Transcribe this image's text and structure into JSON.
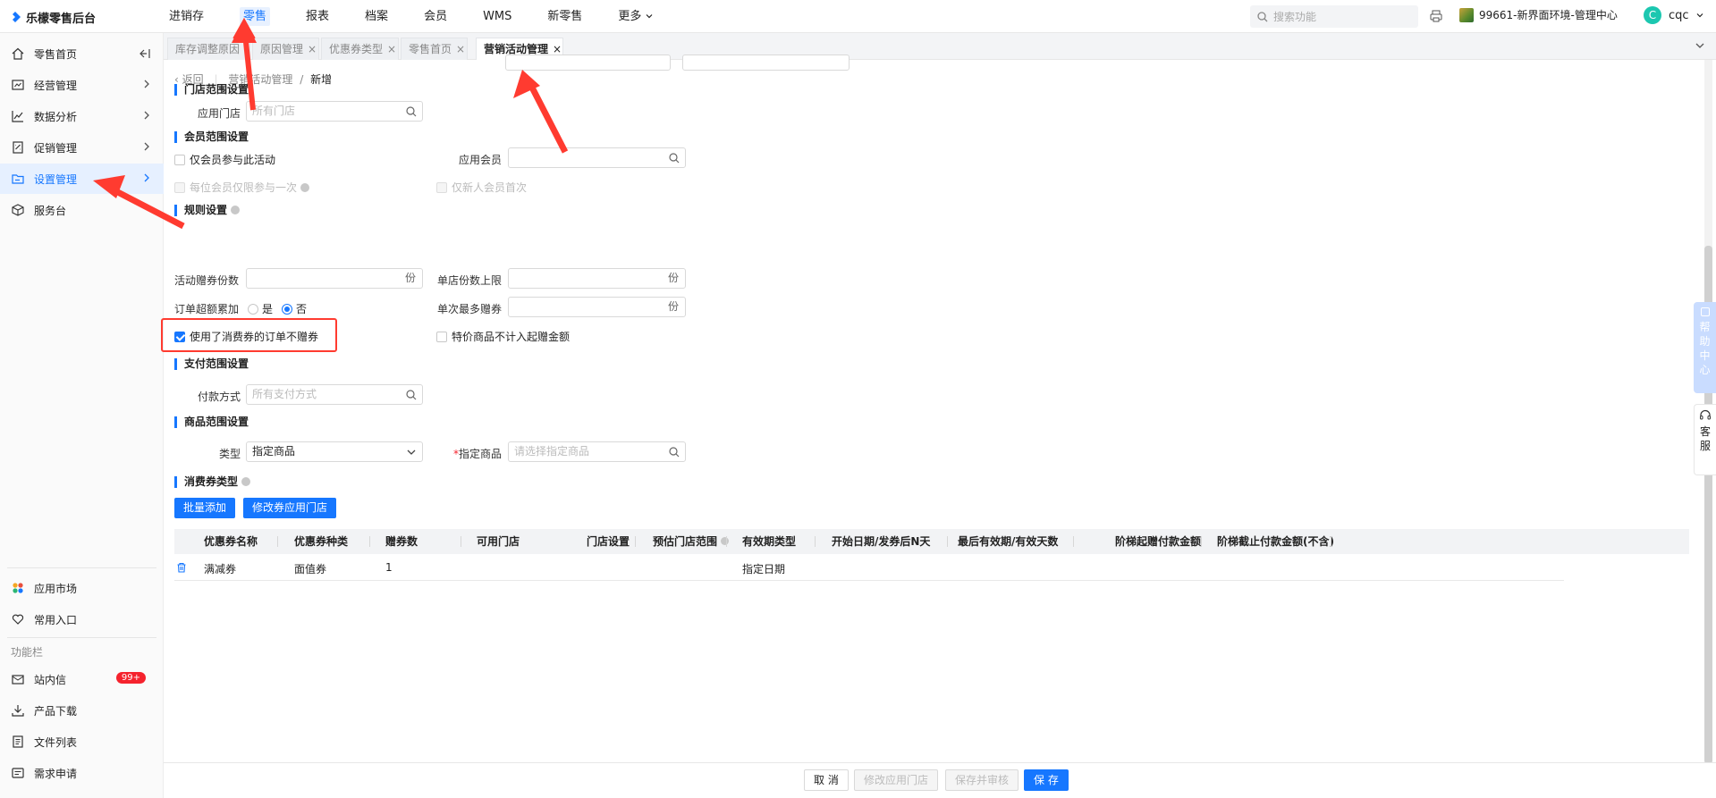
{
  "app": {
    "title": "乐檬零售后台"
  },
  "nav": {
    "items": [
      "进销存",
      "零售",
      "报表",
      "档案",
      "会员",
      "WMS",
      "新零售",
      "更多"
    ],
    "active": "零售"
  },
  "header": {
    "search_placeholder": "搜索功能",
    "store": "99661-新界面环境-管理中心",
    "user_initial": "C",
    "user_name": "cqc"
  },
  "sidebar": {
    "items": [
      {
        "label": "零售首页",
        "icon": "home-icon"
      },
      {
        "label": "经营管理",
        "icon": "chart-board-icon"
      },
      {
        "label": "数据分析",
        "icon": "line-chart-icon"
      },
      {
        "label": "促销管理",
        "icon": "promotion-icon"
      },
      {
        "label": "设置管理",
        "icon": "folder-icon"
      },
      {
        "label": "服务台",
        "icon": "cube-icon"
      }
    ],
    "bottom_items": [
      {
        "label": "应用市场",
        "icon": "app-market-icon"
      },
      {
        "label": "常用入口",
        "icon": "heart-icon"
      }
    ],
    "section_label": "功能栏",
    "function_items": [
      {
        "label": "站内信",
        "icon": "mail-icon",
        "badge": "99+"
      },
      {
        "label": "产品下载",
        "icon": "download-icon"
      },
      {
        "label": "文件列表",
        "icon": "file-list-icon"
      },
      {
        "label": "需求申请",
        "icon": "request-icon"
      }
    ]
  },
  "tabs": [
    {
      "label": "库存调整原因"
    },
    {
      "label": "原因管理"
    },
    {
      "label": "优惠券类型"
    },
    {
      "label": "零售首页"
    },
    {
      "label": "营销活动管理"
    }
  ],
  "breadcrumb": {
    "back": "返回",
    "parent": "营销活动管理",
    "sep": "/",
    "current": "新增"
  },
  "sections": {
    "store_scope": {
      "title": "门店范围设置",
      "store_label": "应用门店",
      "store_placeholder": "所有门店"
    },
    "member_scope": {
      "title": "会员范围设置",
      "only_member": "仅会员参与此活动",
      "member_label": "应用会员",
      "once_per_member": "每位会员仅限参与一次",
      "new_member_first": "仅新人会员首次"
    },
    "rules": {
      "title": "规则设置",
      "gift_count_label": "活动赠券份数",
      "unit": "份",
      "store_limit_label": "单店份数上限",
      "overflow_label": "订单超额累加",
      "opt_yes": "是",
      "opt_no": "否",
      "single_max_label": "单次最多赠券",
      "coupon_used_no_gift": "使用了消费券的订单不赠券",
      "special_price_excluded": "特价商品不计入起赠金额"
    },
    "payment_scope": {
      "title": "支付范围设置",
      "pay_label": "付款方式",
      "pay_placeholder": "所有支付方式"
    },
    "product_scope": {
      "title": "商品范围设置",
      "type_label": "类型",
      "type_value": "指定商品",
      "specify_label": "指定商品",
      "required_mark": "*",
      "specify_placeholder": "请选择指定商品"
    },
    "coupon_type": {
      "title": "消费券类型",
      "batch_add": "批量添加",
      "modify_store": "修改券应用门店"
    }
  },
  "table": {
    "headers": [
      "优惠券名称",
      "优惠券种类",
      "赠券数",
      "可用门店",
      "门店设置",
      "预估门店范围",
      "有效期类型",
      "开始日期/发券后N天",
      "最后有效期/有效天数",
      "阶梯起赠付款金额",
      "阶梯截止付款金额(不含)"
    ],
    "rows": [
      {
        "name": "满减券",
        "kind": "面值券",
        "count": "1",
        "validity_type": "指定日期"
      }
    ]
  },
  "footer": {
    "cancel": "取 消",
    "modify_store": "修改应用门店",
    "save_review": "保存并审核",
    "save": "保 存"
  },
  "floating": {
    "help": "帮助中心",
    "service": "客服"
  },
  "colors": {
    "accent": "#1677ff",
    "annotation": "#ff3b30",
    "badge": "#f5222d"
  }
}
